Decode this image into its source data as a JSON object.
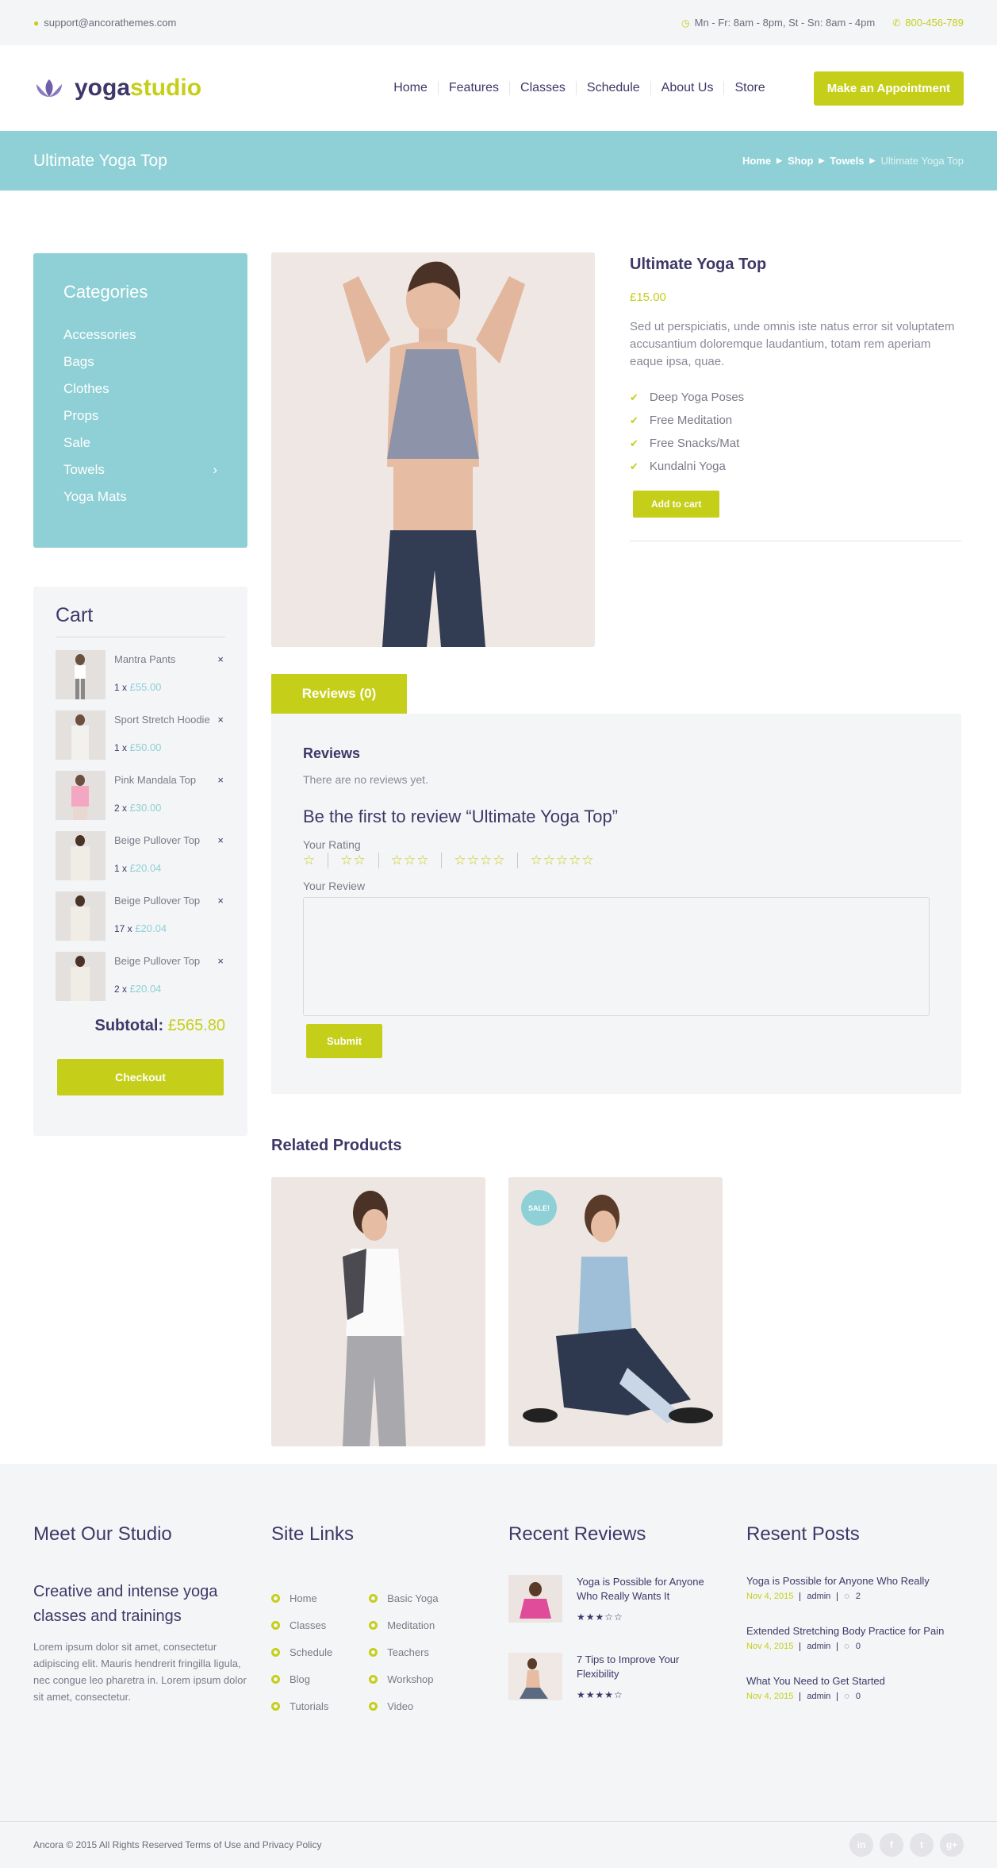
{
  "topbar": {
    "email": "support@ancorathemes.com",
    "hours": "Mn - Fr: 8am - 8pm, St - Sn: 8am - 4pm",
    "phone": "800-456-789"
  },
  "logo": {
    "yoga": "yoga",
    "studio": "studio"
  },
  "nav": {
    "items": [
      "Home",
      "Features",
      "Classes",
      "Schedule",
      "About Us",
      "Store"
    ],
    "cta": "Make an Appointment"
  },
  "banner": {
    "title": "Ultimate Yoga Top",
    "crumbs": [
      "Home",
      "Shop",
      "Towels"
    ],
    "current": "Ultimate Yoga Top"
  },
  "categories": {
    "title": "Categories",
    "items": [
      "Accessories",
      "Bags",
      "Clothes",
      "Props",
      "Sale",
      "Towels",
      "Yoga Mats"
    ]
  },
  "cart": {
    "title": "Cart",
    "items": [
      {
        "name": "Mantra Pants",
        "qty": "1 x",
        "price": "£55.00"
      },
      {
        "name": "Sport Stretch Hoodie",
        "qty": "1 x",
        "price": "£50.00"
      },
      {
        "name": "Pink Mandala Top",
        "qty": "2 x",
        "price": "£30.00"
      },
      {
        "name": "Beige Pullover Top",
        "qty": "1 x",
        "price": "£20.04"
      },
      {
        "name": "Beige Pullover Top",
        "qty": "17 x",
        "price": "£20.04"
      },
      {
        "name": "Beige Pullover Top",
        "qty": "2 x",
        "price": "£20.04"
      }
    ],
    "subtotal_label": "Subtotal:",
    "subtotal": "£565.80",
    "checkout": "Checkout",
    "remove": "×"
  },
  "product": {
    "title": "Ultimate Yoga Top",
    "price": "£15.00",
    "desc": "Sed ut perspiciatis, unde omnis iste natus error sit voluptatem accusantium doloremque laudantium, totam rem aperiam eaque ipsa, quae.",
    "features": [
      "Deep Yoga Poses",
      "Free Meditation",
      "Free Snacks/Mat",
      "Kundalni Yoga"
    ],
    "add": "Add to cart"
  },
  "reviews": {
    "tab": "Reviews (0)",
    "heading": "Reviews",
    "none": "There are no reviews yet.",
    "first": "Be the first to review “Ultimate Yoga Top”",
    "rating_label": "Your Rating",
    "review_label": "Your Review",
    "submit": "Submit",
    "stars": [
      "☆",
      "☆☆",
      "☆☆☆",
      "☆☆☆☆",
      "☆☆☆☆☆"
    ]
  },
  "related": {
    "title": "Related Products",
    "sale": "SALE!"
  },
  "footer": {
    "studio_title": "Meet Our Studio",
    "studio_tag": "Creative and intense yoga classes and trainings",
    "studio_text": "Lorem ipsum dolor sit amet, consectetur adipiscing elit. Mauris hendrerit fringilla ligula, nec congue leo pharetra in. Lorem ipsum dolor sit amet, consectetur.",
    "links_title": "Site Links",
    "links_a": [
      "Home",
      "Classes",
      "Schedule",
      "Blog",
      "Tutorials"
    ],
    "links_b": [
      "Basic Yoga",
      "Meditation",
      "Teachers",
      "Workshop",
      "Video"
    ],
    "reviews_title": "Recent Reviews",
    "recent": [
      {
        "title": "Yoga is Possible for Anyone Who Really Wants It",
        "stars": "★★★☆☆"
      },
      {
        "title": "7 Tips to Improve Your Flexibility",
        "stars": "★★★★☆"
      }
    ],
    "posts_title": "Resent Posts",
    "posts": [
      {
        "title": "Yoga is Possible for Anyone Who Really",
        "date": "Nov 4, 2015",
        "author": "admin",
        "comments": "2"
      },
      {
        "title": "Extended Stretching Body Practice for Pain",
        "date": "Nov 4, 2015",
        "author": "admin",
        "comments": "0"
      },
      {
        "title": "What You Need to Get Started",
        "date": "Nov 4, 2015",
        "author": "admin",
        "comments": "0"
      }
    ],
    "copyright": "Ancora © 2015 All Rights Reserved Terms of Use and Privacy Policy",
    "socials": [
      "in",
      "f",
      "t",
      "g+"
    ]
  },
  "colors": {
    "accent": "#c5cf1a",
    "teal": "#8ed0d6",
    "navy": "#3d3867"
  }
}
